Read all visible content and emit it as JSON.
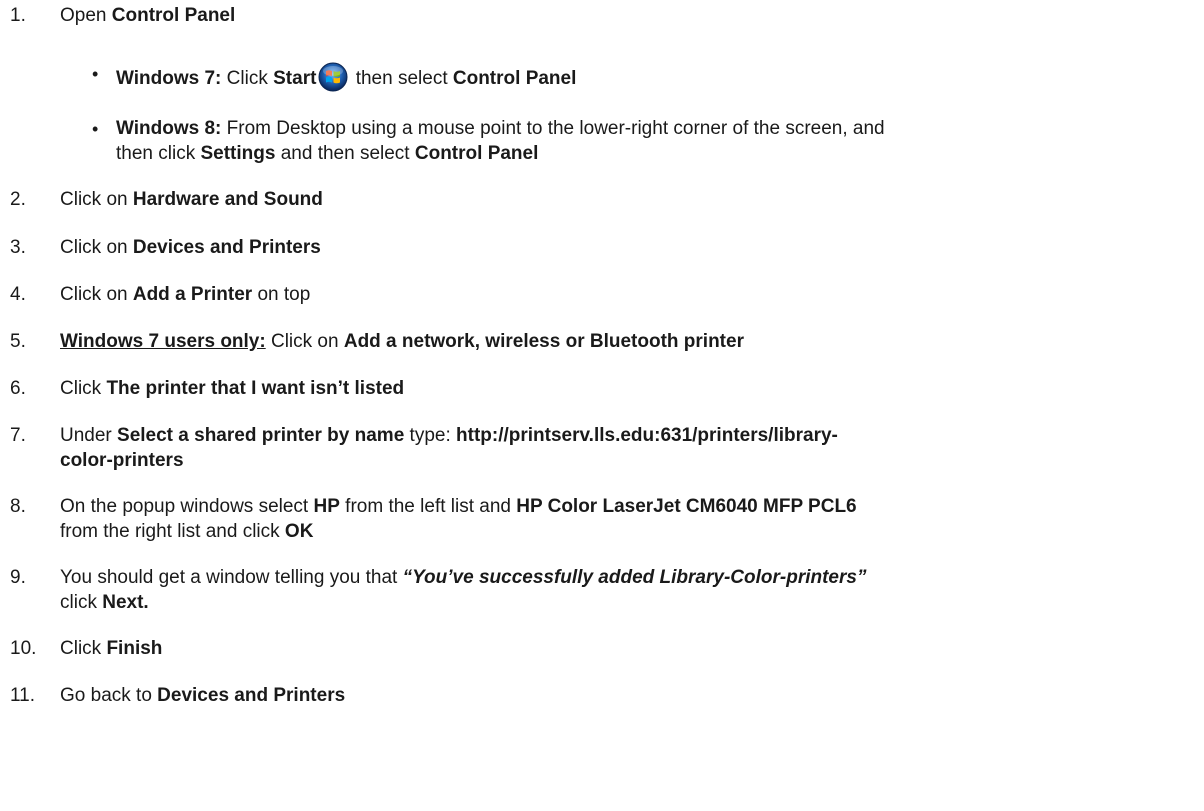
{
  "steps": [
    {
      "num": "1.",
      "parts": [
        "Open ",
        "Control Panel"
      ]
    },
    {
      "num": "2.",
      "parts": [
        "Click on ",
        "Hardware and Sound"
      ]
    },
    {
      "num": "3.",
      "parts": [
        "Click on ",
        "Devices and Printers"
      ]
    },
    {
      "num": "4.",
      "parts": [
        "Click on ",
        "Add a Printer",
        " on top"
      ]
    },
    {
      "num": "5.",
      "parts": [
        "Windows 7 users only:",
        " Click on  ",
        "Add a network, wireless or Bluetooth printer"
      ]
    },
    {
      "num": "6.",
      "parts": [
        "Click  ",
        "The printer that I want isn’t listed"
      ]
    },
    {
      "num": "7.",
      "parts": [
        "Under ",
        "Select a shared printer by name",
        " type: ",
        "http://printserv.lls.edu:631/printers/library-",
        "color-printers"
      ]
    },
    {
      "num": "8.",
      "parts": [
        "On the popup windows select ",
        "HP",
        " from the left list and ",
        "HP Color LaserJet CM6040 MFP PCL6",
        "from the right list and click ",
        "OK"
      ]
    },
    {
      "num": "9.",
      "parts": [
        "You should get a window telling you that ",
        "“You’ve successfully added Library-Color-printers”",
        "click ",
        "Next."
      ]
    },
    {
      "num": "10.",
      "parts": [
        "Click ",
        "Finish"
      ]
    },
    {
      "num": "11.",
      "parts": [
        "Go back to ",
        "Devices and Printers"
      ]
    }
  ],
  "substeps": [
    {
      "bullet": "•",
      "parts": [
        "Windows 7:",
        " Click ",
        "Start",
        " then select ",
        "Control Panel"
      ],
      "icon": "windows-start-orb-icon"
    },
    {
      "bullet": "•",
      "parts": [
        "Windows 8:",
        " From Desktop using a mouse point to the lower-right corner of the screen, and",
        "then click ",
        "Settings",
        " and then select ",
        "Control Panel"
      ]
    }
  ],
  "colors": {
    "text": "#1a1a1a",
    "background": "#ffffff"
  }
}
